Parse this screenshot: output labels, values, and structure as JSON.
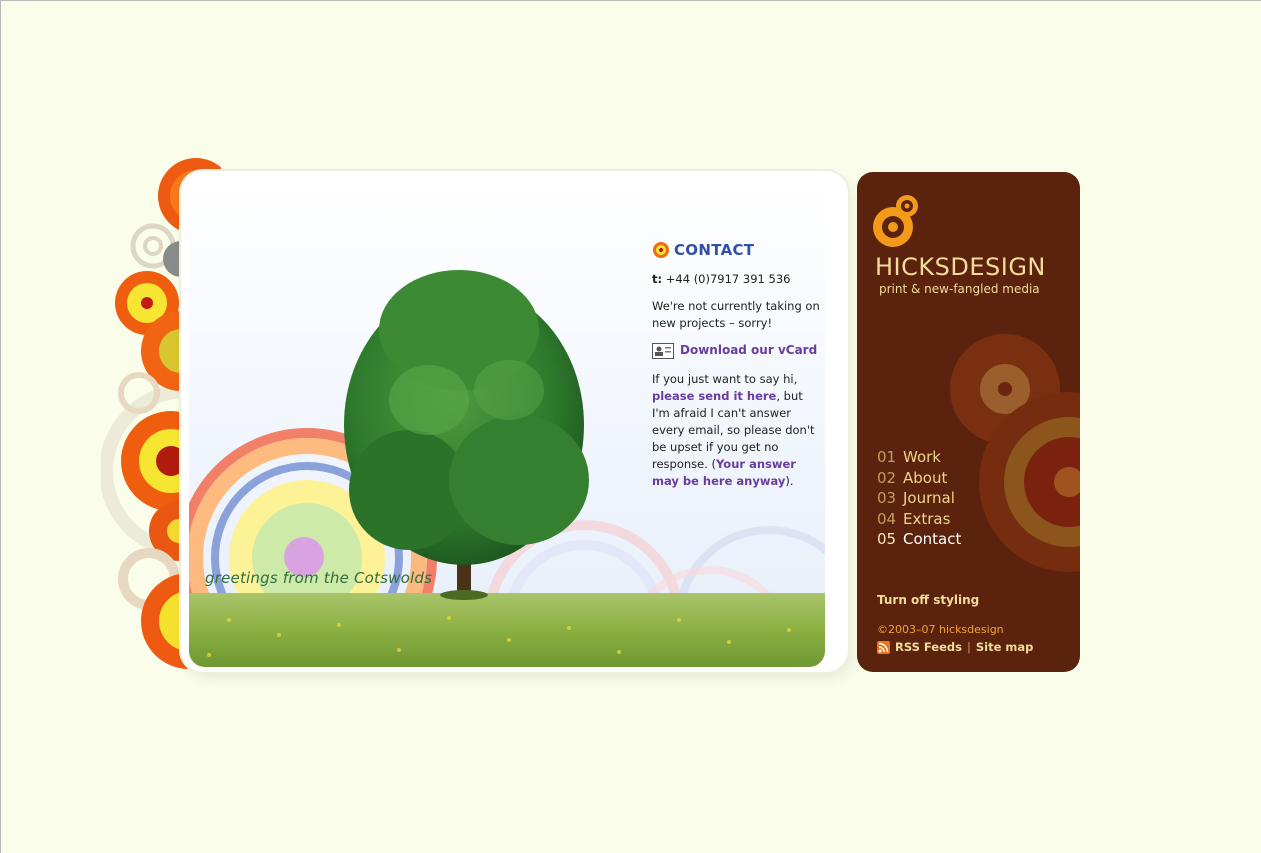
{
  "greeting": "greetings from the Cotswolds",
  "contact": {
    "heading": "CONTACT",
    "phone_label": "t:",
    "phone": "+44 (0)7917 391 536",
    "notice": "We're not currently taking on new projects – sorry!",
    "vcard_label": "Download our vCard",
    "msg_pre": "If you just want to say hi,",
    "msg_link": "please send it here",
    "msg_mid": ", but I'm afraid I can't answer every email, so please don't be upset if you get no response. (",
    "msg_link2": "Your answer may be here anyway",
    "msg_end": ")."
  },
  "brand": {
    "name": "HICKSDESIGN",
    "tagline": "print & new-fangled media"
  },
  "nav": [
    {
      "num": "01",
      "label": "Work"
    },
    {
      "num": "02",
      "label": "About"
    },
    {
      "num": "03",
      "label": "Journal"
    },
    {
      "num": "04",
      "label": "Extras"
    },
    {
      "num": "05",
      "label": "Contact"
    }
  ],
  "turn_off": "Turn off styling",
  "copyright": "©2003–07 hicksdesign",
  "footer": {
    "rss": "RSS Feeds",
    "separator": "|",
    "sitemap": "Site map"
  },
  "colors": {
    "page_bg": "#fafde9",
    "sidebar": "#5b230d",
    "link": "#6a3c9e",
    "heading": "#2f4fa8"
  }
}
